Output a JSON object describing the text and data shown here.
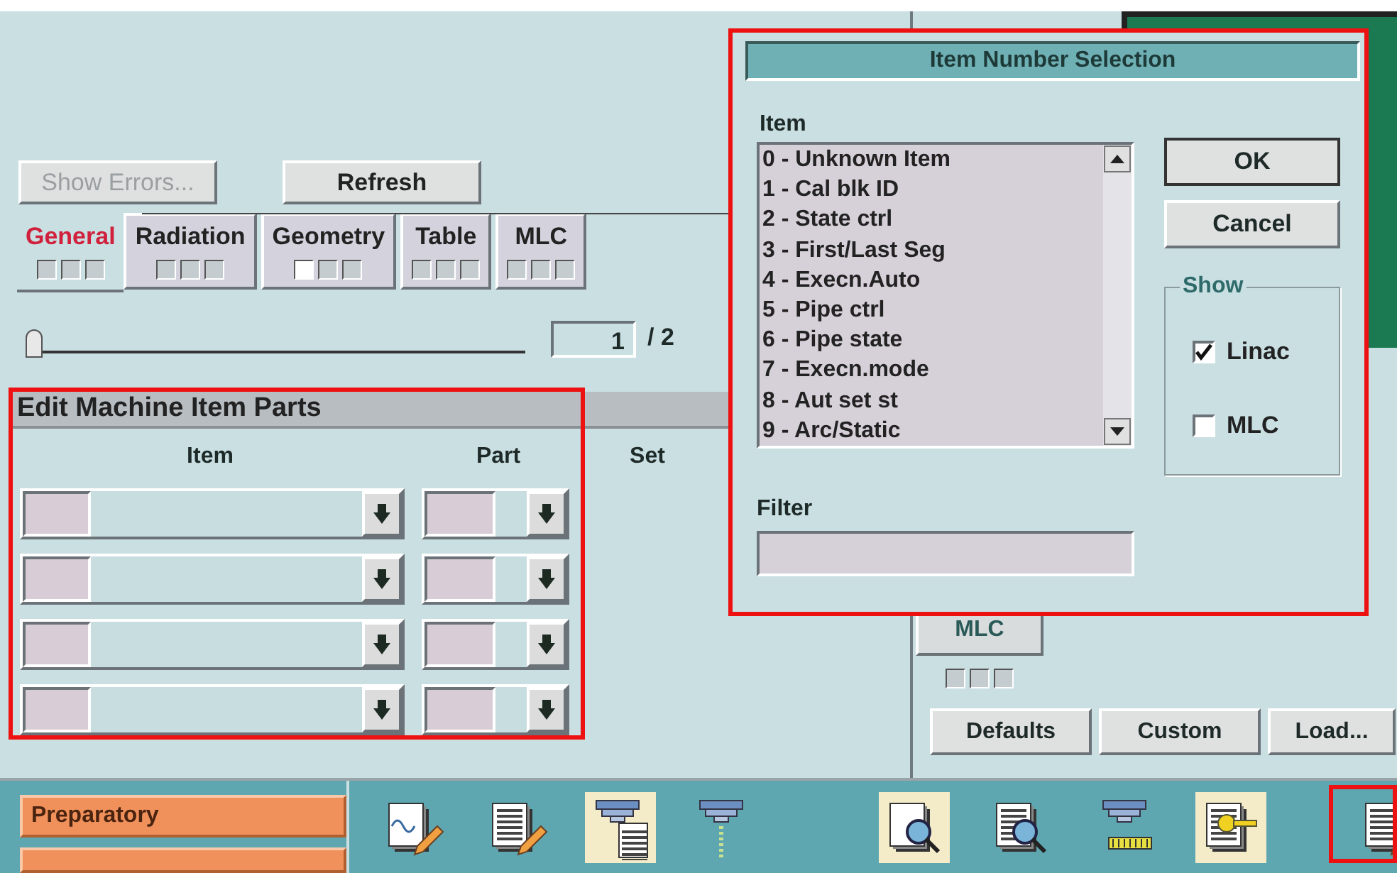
{
  "toolbar": {
    "buttons": [
      {
        "label": "Show Errors...",
        "disabled": true
      },
      {
        "label": "Refresh",
        "disabled": false
      }
    ]
  },
  "tabs": [
    {
      "label": "General",
      "selected": true,
      "flags": [
        false,
        false,
        false
      ]
    },
    {
      "label": "Radiation",
      "selected": false,
      "flags": [
        false,
        false,
        false
      ]
    },
    {
      "label": "Geometry",
      "selected": false,
      "flags": [
        true,
        false,
        false
      ]
    },
    {
      "label": "Table",
      "selected": false,
      "flags": [
        false,
        false,
        false
      ]
    },
    {
      "label": "MLC",
      "selected": false,
      "flags": [
        false,
        false,
        false
      ]
    }
  ],
  "slider": {
    "level": 0
  },
  "page": {
    "current": "1",
    "total": "/ 2"
  },
  "edit_parts": {
    "title": "Edit Machine Item Parts",
    "columns": [
      "Item",
      "Part",
      "Set"
    ]
  },
  "side_tab": {
    "label": "MLC",
    "flags": [
      false,
      false,
      false
    ]
  },
  "actions": [
    "Defaults",
    "Custom",
    "Load..."
  ],
  "dialog": {
    "title": "Item Number Selection",
    "list_label": "Item",
    "items": [
      {
        "label": "0 - Unknown Item",
        "selected": false
      },
      {
        "label": "1 - Cal blk ID",
        "selected": false
      },
      {
        "label": "2 - State ctrl",
        "selected": false
      },
      {
        "label": "3 - First/Last Seg",
        "selected": false
      },
      {
        "label": "4 - Execn.Auto",
        "selected": false
      },
      {
        "label": "5 - Pipe ctrl",
        "selected": false
      },
      {
        "label": "6 - Pipe state",
        "selected": false
      },
      {
        "label": "7 - Execn.mode",
        "selected": false
      },
      {
        "label": "8 - Aut set st",
        "selected": false
      },
      {
        "label": "9 - Arc/Static",
        "selected": false
      }
    ],
    "buttons": [
      "OK",
      "Cancel"
    ],
    "show": {
      "title": "Show",
      "options": [
        {
          "label": "Linac",
          "checked": true
        },
        {
          "label": "MLC",
          "checked": false
        }
      ]
    },
    "filter": {
      "label": "Filter"
    }
  },
  "sidebar": [
    {
      "label": "Preparatory"
    }
  ],
  "tools": [
    {
      "kind": "wave-edit",
      "selected": false
    },
    {
      "kind": "doc-edit",
      "selected": false
    },
    {
      "kind": "machine-doc",
      "selected": true
    },
    {
      "kind": "machine-dots",
      "selected": false
    },
    {
      "kind": "doc-search",
      "selected": true
    },
    {
      "kind": "list-search",
      "selected": false
    },
    {
      "kind": "machine-ruler",
      "selected": false
    },
    {
      "kind": "doc-key",
      "selected": true
    },
    {
      "kind": "list-edit",
      "selected": false
    }
  ]
}
